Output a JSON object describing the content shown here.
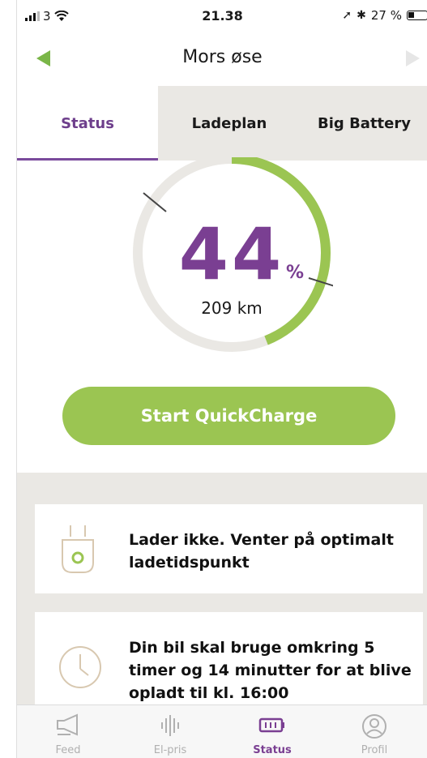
{
  "status_bar": {
    "carrier": "3",
    "time": "21.38",
    "battery": "27 %"
  },
  "header": {
    "title": "Mors øse"
  },
  "tabs": [
    {
      "label": "Status"
    },
    {
      "label": "Ladeplan"
    },
    {
      "label": "Big Battery"
    }
  ],
  "gauge": {
    "percent": "44",
    "percent_symbol": "%",
    "range": "209 km",
    "fill_fraction": 0.44
  },
  "quickcharge": {
    "label": "Start QuickCharge"
  },
  "cards": [
    {
      "text": "Lader ikke. Venter på optimalt ladetidspunkt",
      "icon": "plug-icon"
    },
    {
      "text": "Din bil skal bruge omkring 5 timer og 14 minutter for at blive opladt til kl. 16:00",
      "icon": "clock-icon"
    }
  ],
  "bottom_nav": [
    {
      "label": "Feed",
      "icon": "megaphone-icon"
    },
    {
      "label": "El-pris",
      "icon": "soundwave-icon"
    },
    {
      "label": "Status",
      "icon": "battery-icon"
    },
    {
      "label": "Profil",
      "icon": "profile-icon"
    }
  ],
  "colors": {
    "accent_green": "#9bc552",
    "accent_purple": "#7a3f92",
    "panel_gray": "#eae8e4"
  }
}
